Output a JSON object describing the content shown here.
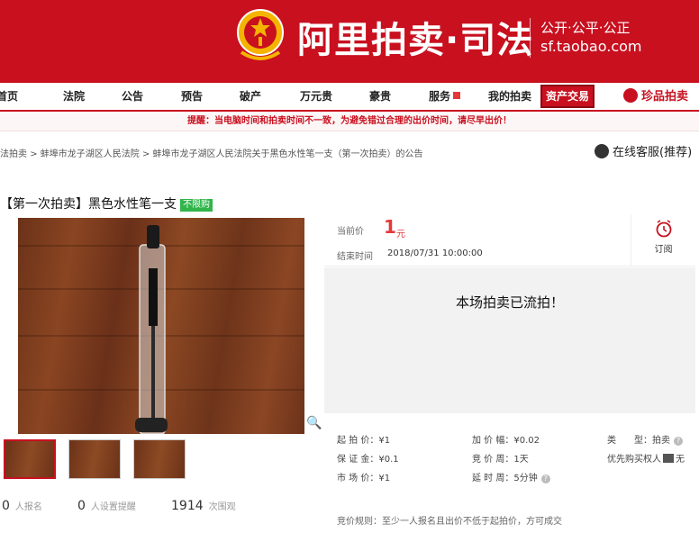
{
  "brand": {
    "title": "阿里拍卖·司法",
    "slogan": "公开·公平·公正",
    "domain": "sf.taobao.com"
  },
  "nav": {
    "items": [
      "首页",
      "法院",
      "公告",
      "预告",
      "破产",
      "万元贵",
      "豪贵",
      "服务",
      "我的拍卖"
    ],
    "asset_trade": "资产交易",
    "treasure": "珍品拍卖"
  },
  "notice": "提醒：当电脑时间和拍卖时间不一致，为避免错过合理的出价时间，请尽早出价！",
  "breadcrumb": {
    "items": [
      "法拍卖",
      "蚌埠市龙子湖区人民法院",
      "蚌埠市龙子湖区人民法院关于黑色水性笔一支（第一次拍卖）的公告"
    ],
    "separator": ">"
  },
  "service": "在线客服(推荐)",
  "item": {
    "title": "【第一次拍卖】黑色水性笔一支",
    "badge": "不限购"
  },
  "price": {
    "current_label": "当前价",
    "current_value": "1",
    "unit": "元",
    "end_label": "结束时间",
    "end_time": "2018/07/31 10:00:00",
    "subscribe": "订阅"
  },
  "status": "本场拍卖已流拍！",
  "terms": {
    "start_price": {
      "label": "起 拍 价：",
      "value": "¥1"
    },
    "increment": {
      "label": "加 价 幅：",
      "value": "¥0.02"
    },
    "type": {
      "label": "类　　型：",
      "value": "拍卖"
    },
    "deposit": {
      "label": "保 证 金：",
      "value": "¥0.1"
    },
    "period": {
      "label": "竞 价 周：",
      "value": "1天"
    },
    "priority": {
      "label": "优先购买权人",
      "value": "无"
    },
    "market_price": {
      "label": "市 场 价：",
      "value": "¥1"
    },
    "delay": {
      "label": "延 时 周：",
      "value": "5分钟"
    }
  },
  "rule": {
    "label": "竞价规则：",
    "text": "至少一人报名且出价不低于起拍价，方可成交"
  },
  "stats": {
    "signup_count": "0",
    "signup_label": "人报名",
    "remind_count": "0",
    "remind_label": "人设置提醒",
    "view_count": "1914",
    "view_label": "次围观"
  },
  "icons": {
    "zoom": "magnifier-icon",
    "subscribe": "clock-icon",
    "service": "headset-icon"
  },
  "colors": {
    "brand_red": "#c8101f",
    "price_red": "#e4393c",
    "badge_green": "#2fb54a"
  }
}
